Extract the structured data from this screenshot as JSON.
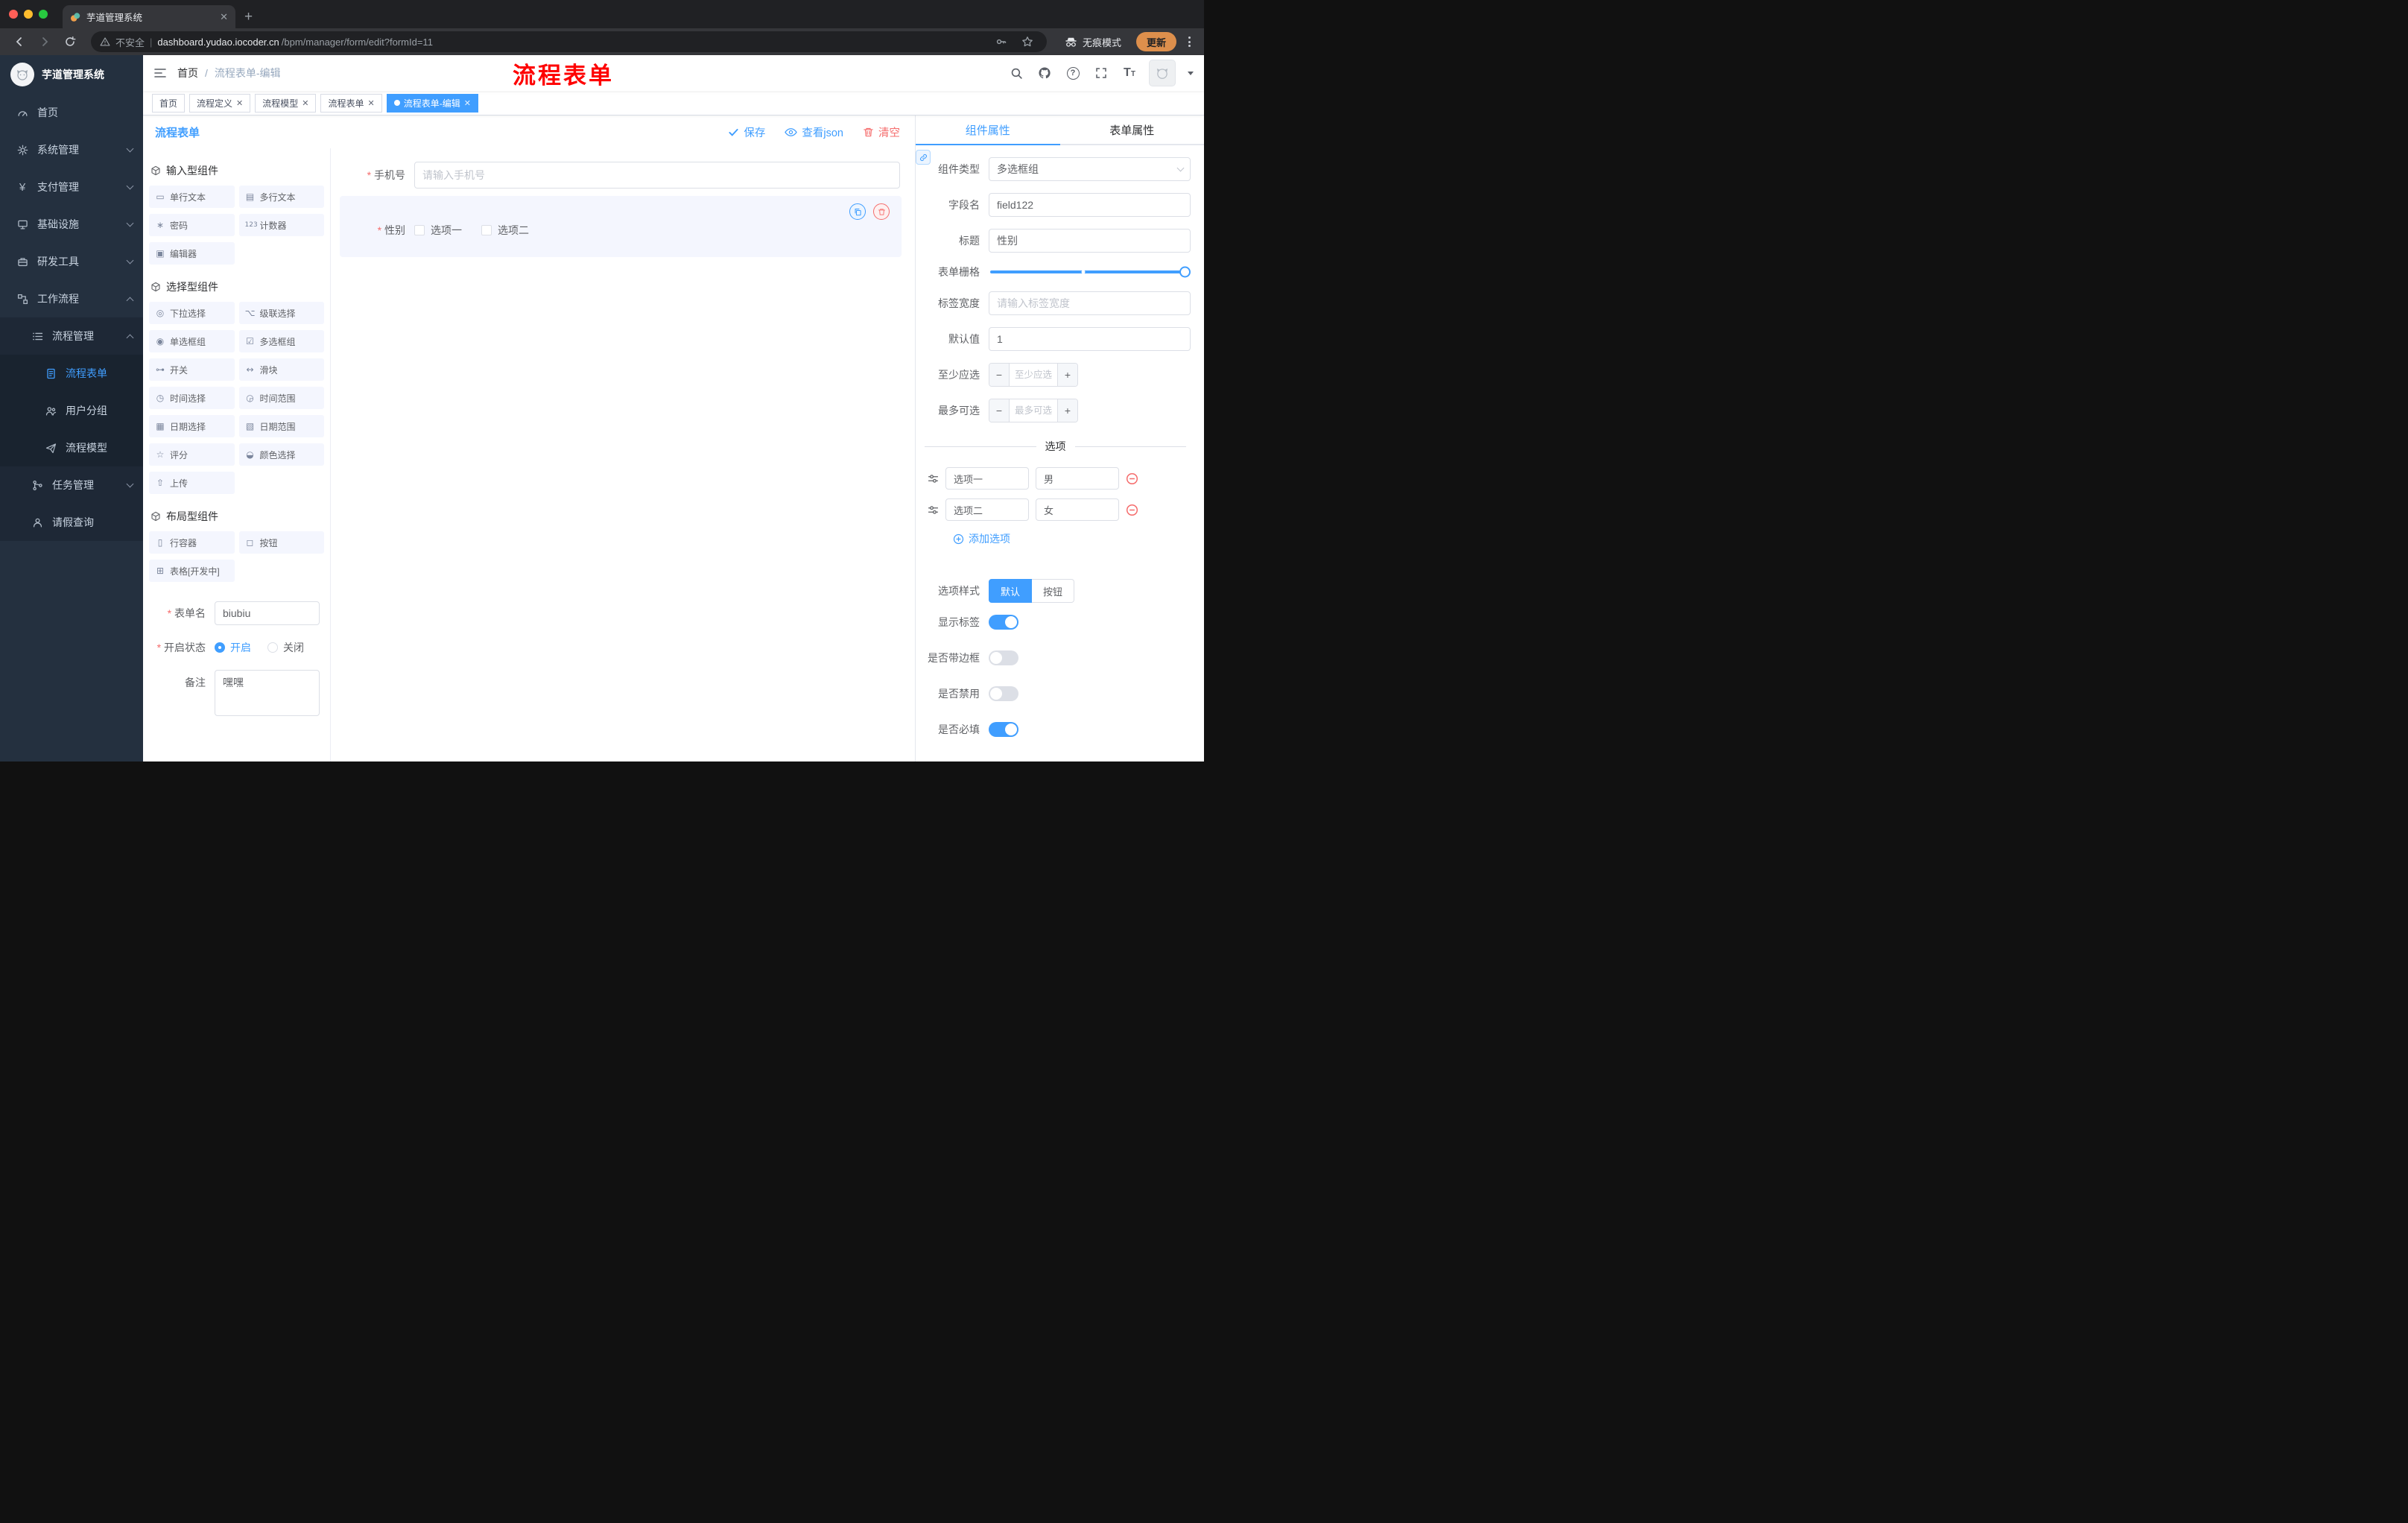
{
  "colors": {
    "accent": "#409eff",
    "danger": "#f56c6c",
    "sidebar_bg": "#24303f",
    "chrome_bg": "#35363a"
  },
  "browser": {
    "tab_title": "芋道管理系统",
    "security_label": "不安全",
    "url_domain": "dashboard.yudao.iocoder.cn",
    "url_path": "/bpm/manager/form/edit?formId=11",
    "incognito_label": "无痕模式",
    "update_label": "更新"
  },
  "annotation_text": "流程表单",
  "sidebar": {
    "app_title": "芋道管理系统",
    "items": [
      {
        "label": "首页",
        "icon": "gauge-icon"
      },
      {
        "label": "系统管理",
        "icon": "gear-icon"
      },
      {
        "label": "支付管理",
        "icon": "yen-icon"
      },
      {
        "label": "基础设施",
        "icon": "monitor-icon"
      },
      {
        "label": "研发工具",
        "icon": "toolbox-icon"
      },
      {
        "label": "工作流程",
        "icon": "workflow-icon"
      },
      {
        "label": "流程管理",
        "icon": "list-icon"
      },
      {
        "label": "流程表单",
        "icon": "document-icon",
        "active": true
      },
      {
        "label": "用户分组",
        "icon": "users-icon"
      },
      {
        "label": "流程模型",
        "icon": "send-icon"
      },
      {
        "label": "任务管理",
        "icon": "branch-icon"
      },
      {
        "label": "请假查询",
        "icon": "person-icon"
      }
    ]
  },
  "navbar": {
    "breadcrumb": [
      "首页",
      "流程表单-编辑"
    ]
  },
  "tags": [
    {
      "label": "首页",
      "closable": false,
      "active": false
    },
    {
      "label": "流程定义",
      "closable": true,
      "active": false
    },
    {
      "label": "流程模型",
      "closable": true,
      "active": false
    },
    {
      "label": "流程表单",
      "closable": true,
      "active": false
    },
    {
      "label": "流程表单-编辑",
      "closable": true,
      "active": true
    }
  ],
  "designer": {
    "title": "流程表单",
    "actions": {
      "save": "保存",
      "view_json": "查看json",
      "clear": "清空"
    },
    "groups": [
      {
        "title": "输入型组件",
        "items": [
          {
            "label": "单行文本",
            "icon": "▭"
          },
          {
            "label": "多行文本",
            "icon": "▤"
          },
          {
            "label": "密码",
            "icon": "∗"
          },
          {
            "label": "计数器",
            "icon": "123"
          },
          {
            "label": "编辑器",
            "icon": "▣"
          }
        ]
      },
      {
        "title": "选择型组件",
        "items": [
          {
            "label": "下拉选择",
            "icon": "◎"
          },
          {
            "label": "级联选择",
            "icon": "⌥"
          },
          {
            "label": "单选框组",
            "icon": "◉"
          },
          {
            "label": "多选框组",
            "icon": "☑"
          },
          {
            "label": "开关",
            "icon": "⊶"
          },
          {
            "label": "滑块",
            "icon": "↔"
          },
          {
            "label": "时间选择",
            "icon": "◷"
          },
          {
            "label": "时间范围",
            "icon": "◶"
          },
          {
            "label": "日期选择",
            "icon": "▦"
          },
          {
            "label": "日期范围",
            "icon": "▧"
          },
          {
            "label": "评分",
            "icon": "☆"
          },
          {
            "label": "颜色选择",
            "icon": "◒"
          },
          {
            "label": "上传",
            "icon": "⇧"
          }
        ]
      },
      {
        "title": "布局型组件",
        "items": [
          {
            "label": "行容器",
            "icon": "▯"
          },
          {
            "label": "按钮",
            "icon": "◻"
          },
          {
            "label": "表格[开发中]",
            "icon": "⊞"
          }
        ]
      }
    ],
    "meta_form": {
      "name_label": "表单名",
      "name_value": "biubiu",
      "status_label": "开启状态",
      "status_on": "开启",
      "status_off": "关闭",
      "remark_label": "备注",
      "remark_value": "嘿嘿"
    }
  },
  "canvas": {
    "phone": {
      "label": "手机号",
      "placeholder": "请输入手机号",
      "required": true
    },
    "gender": {
      "label": "性别",
      "required": true,
      "options": [
        "选项一",
        "选项二"
      ]
    }
  },
  "props": {
    "tabs": {
      "component": "组件属性",
      "form": "表单属性"
    },
    "component_type": {
      "label": "组件类型",
      "value": "多选框组"
    },
    "field_name": {
      "label": "字段名",
      "value": "field122"
    },
    "title_row": {
      "label": "标题",
      "value": "性别"
    },
    "grid": {
      "label": "表单栅格"
    },
    "label_width": {
      "label": "标签宽度",
      "placeholder": "请输入标签宽度"
    },
    "default_value": {
      "label": "默认值",
      "value": "1"
    },
    "min_select": {
      "label": "至少应选",
      "placeholder": "至少应选"
    },
    "max_select": {
      "label": "最多可选",
      "placeholder": "最多可选"
    },
    "options_title": "选项",
    "options": [
      {
        "label": "选项一",
        "value": "男"
      },
      {
        "label": "选项二",
        "value": "女"
      }
    ],
    "add_option": "添加选项",
    "option_style": {
      "label": "选项样式",
      "default": "默认",
      "button": "按钮"
    },
    "switches": [
      {
        "label": "显示标签",
        "on": true
      },
      {
        "label": "是否带边框",
        "on": false
      },
      {
        "label": "是否禁用",
        "on": false
      },
      {
        "label": "是否必填",
        "on": true
      }
    ]
  }
}
